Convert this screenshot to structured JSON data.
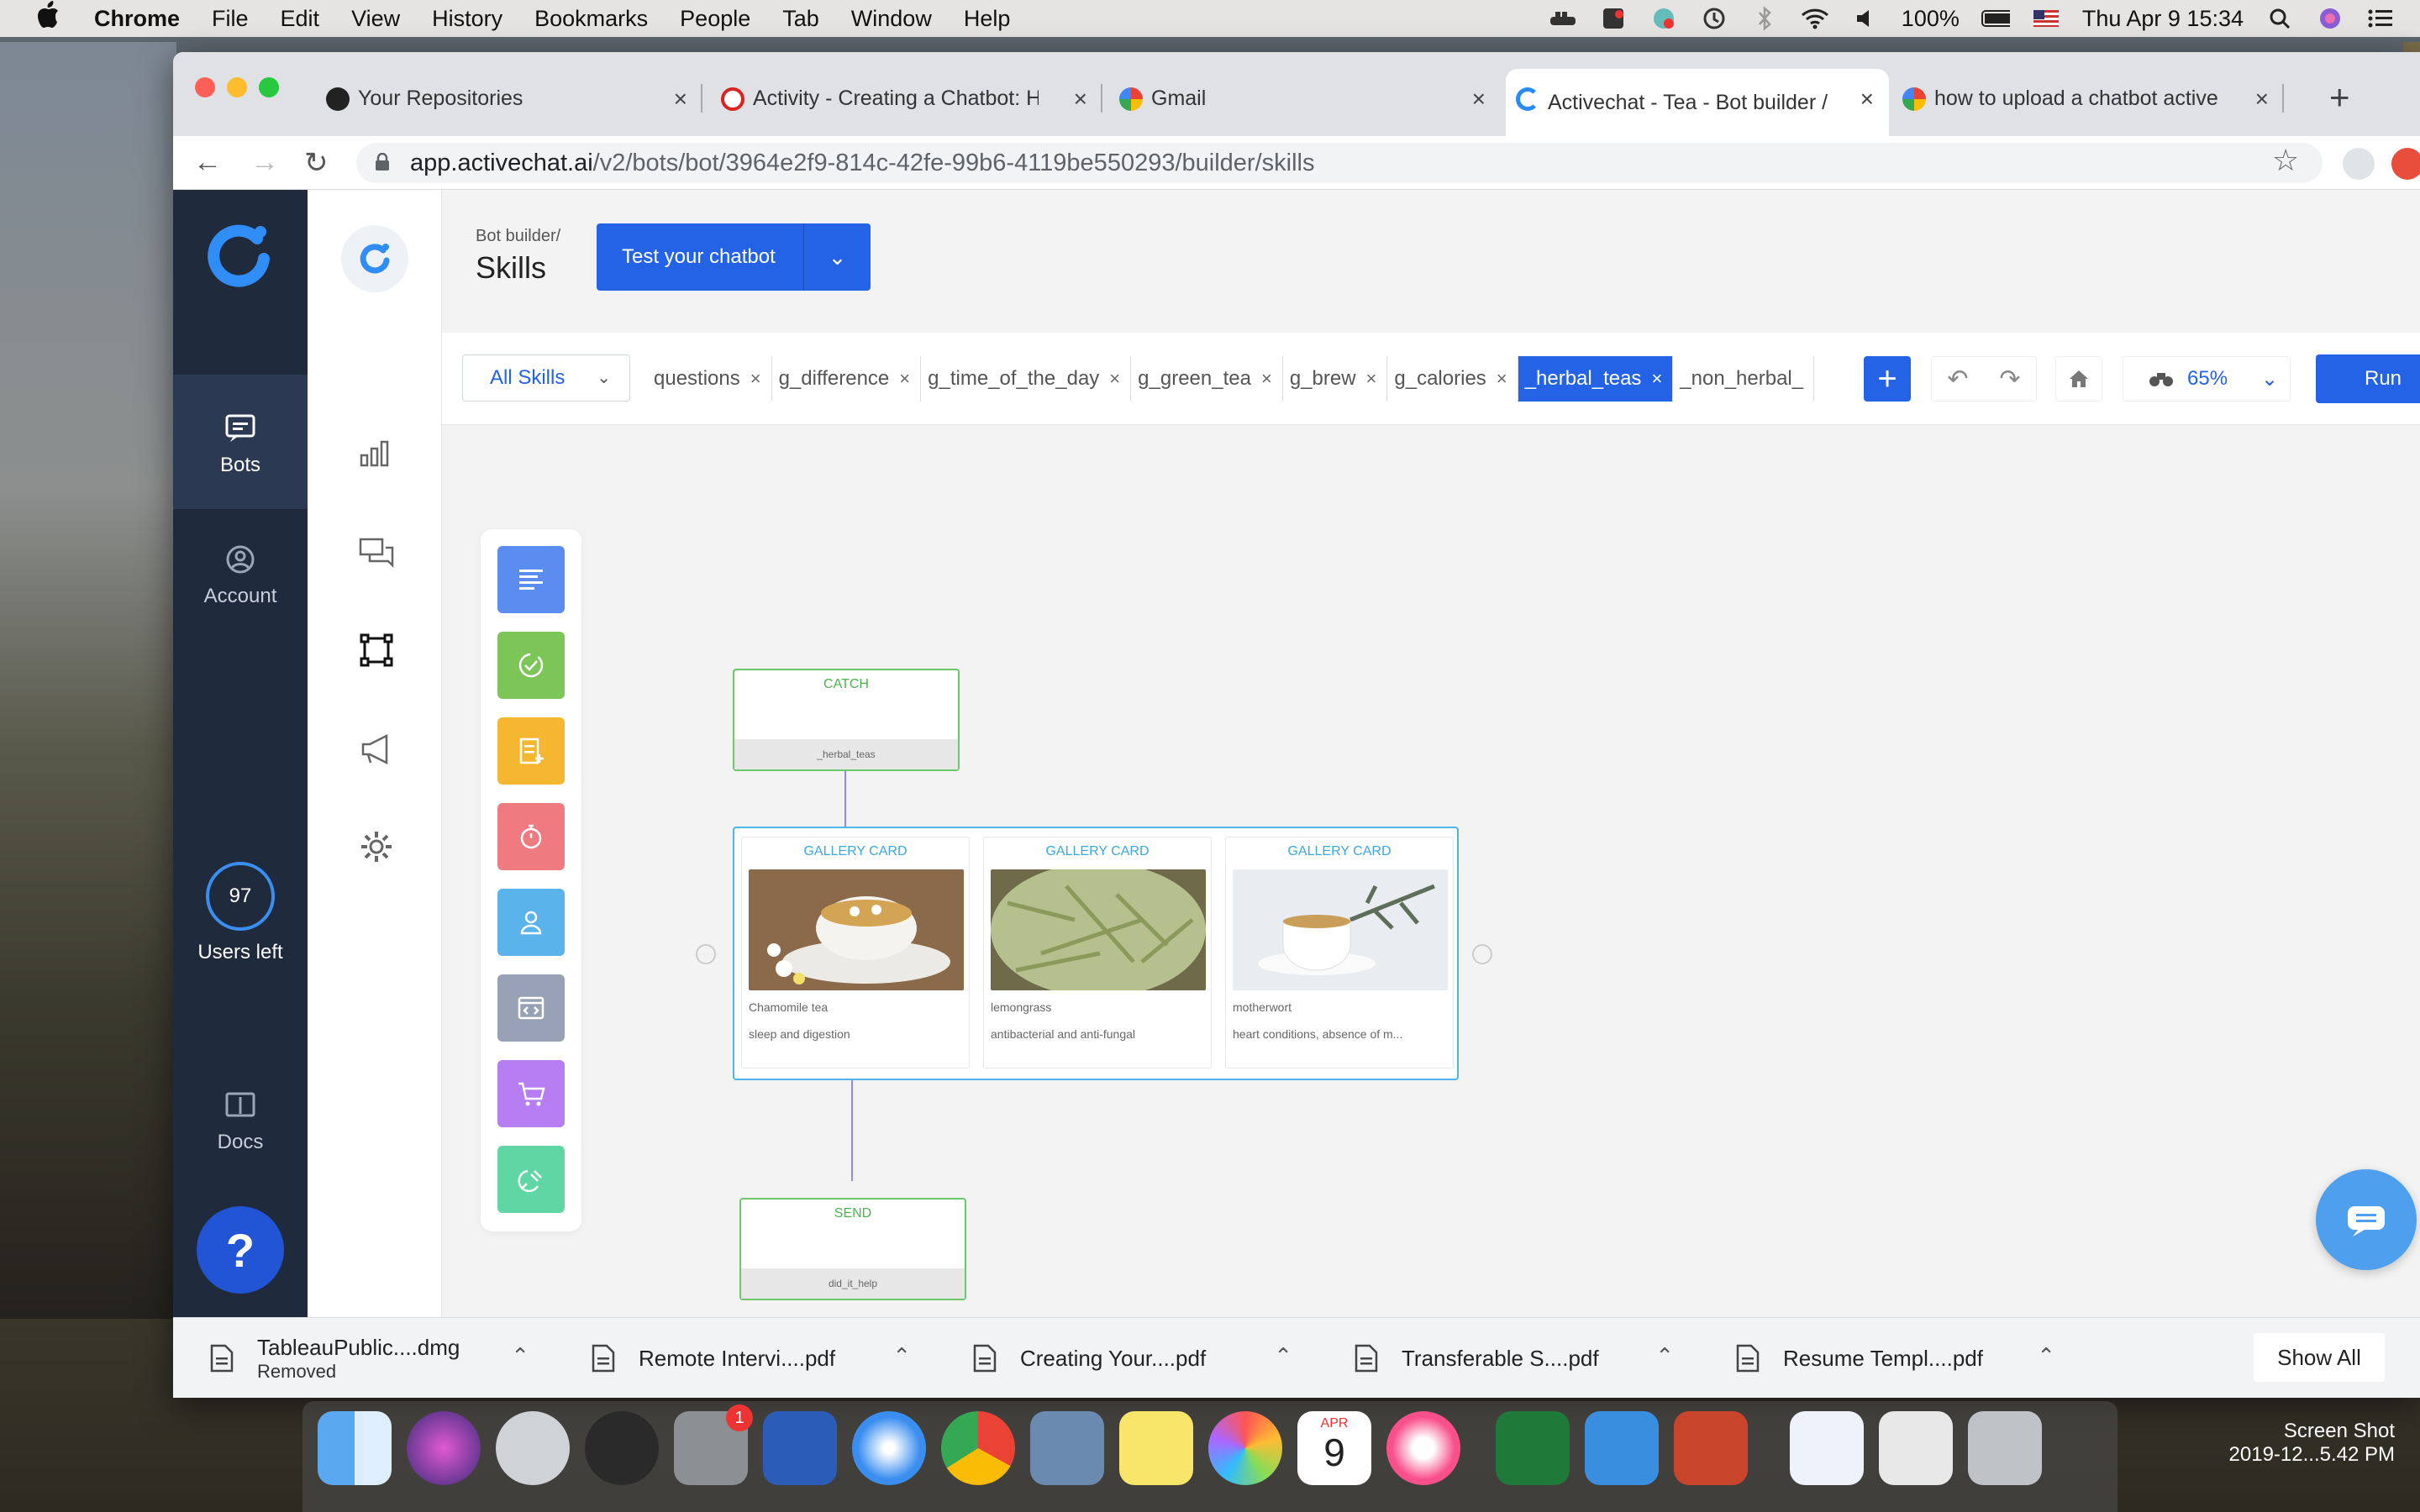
{
  "menubar": {
    "app": "Chrome",
    "items": [
      "File",
      "Edit",
      "View",
      "History",
      "Bookmarks",
      "People",
      "Tab",
      "Window",
      "Help"
    ],
    "battery": "100%",
    "datetime": "Thu Apr 9  15:34"
  },
  "tabs": [
    {
      "title": "Your Repositories",
      "favicon": "github-icon"
    },
    {
      "title": "Activity - Creating a Chatbot: H",
      "favicon": "opera-icon"
    },
    {
      "title": "Gmail",
      "favicon": "google-icon"
    },
    {
      "title": "Activechat - Tea - Bot builder /",
      "favicon": "activechat-icon"
    },
    {
      "title": "how to upload a chatbot active",
      "favicon": "google-icon"
    }
  ],
  "address": {
    "host": "app.activechat.ai",
    "path": "/v2/bots/bot/3964e2f9-814c-42fe-99b6-4119be550293/builder/skills"
  },
  "rail": {
    "bots_label": "Bots",
    "account_label": "Account",
    "users_count": "97",
    "users_label": "Users left",
    "docs_label": "Docs",
    "help_label": "?"
  },
  "header": {
    "breadcrumb": "Bot builder/",
    "title": "Skills",
    "test_button": "Test your chatbot"
  },
  "skillbar": {
    "all_skills": "All Skills",
    "chips": [
      "questions",
      "g_difference",
      "g_time_of_the_day",
      "g_green_tea",
      "g_brew",
      "g_calories",
      "_herbal_teas",
      "_non_herbal_"
    ],
    "selected_chip": "_herbal_teas",
    "zoom": "65%",
    "run_label": "Run"
  },
  "flow": {
    "catch_node": {
      "title": "CATCH",
      "footer": "_herbal_teas"
    },
    "gallery_cards": [
      {
        "title": "GALLERY CARD",
        "name": "Chamomile tea",
        "desc": "sleep and digestion"
      },
      {
        "title": "GALLERY CARD",
        "name": "lemongrass",
        "desc": "antibacterial and anti-fungal"
      },
      {
        "title": "GALLERY CARD",
        "name": "motherwort",
        "desc": "heart conditions, absence of m..."
      }
    ],
    "send_node": {
      "title": "SEND",
      "footer": "did_it_help"
    }
  },
  "downloads": [
    {
      "name": "TableauPublic....dmg",
      "status": "Removed"
    },
    {
      "name": "Remote Intervi....pdf"
    },
    {
      "name": "Creating Your....pdf"
    },
    {
      "name": "Transferable S....pdf"
    },
    {
      "name": "Resume Templ....pdf"
    }
  ],
  "downloads_show_all": "Show All",
  "desktop": {
    "screenshot_label_1": "Screen Shot",
    "screenshot_label_2": "2019-12...5.42 PM",
    "calendar_month": "APR",
    "calendar_day": "9",
    "notification_badge": "1"
  },
  "colors": {
    "accent": "#2463e6",
    "rail": "#1f2a3c",
    "catch_green": "#49b649",
    "gallery_blue": "#3aa7e2"
  }
}
